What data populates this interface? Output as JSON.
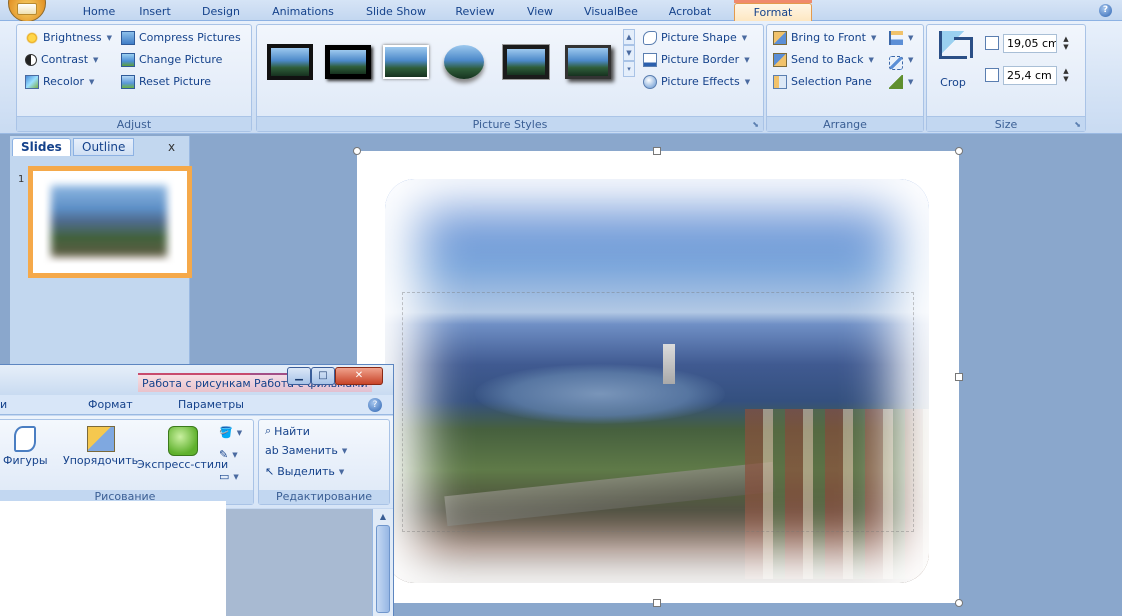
{
  "ribbon_tabs": [
    {
      "label": "Home"
    },
    {
      "label": "Insert"
    },
    {
      "label": "Design"
    },
    {
      "label": "Animations"
    },
    {
      "label": "Slide Show"
    },
    {
      "label": "Review"
    },
    {
      "label": "View"
    },
    {
      "label": "VisualBee"
    },
    {
      "label": "Acrobat"
    },
    {
      "label": "Format"
    }
  ],
  "active_tab": "Format",
  "adjust": {
    "brightness": "Brightness",
    "contrast": "Contrast",
    "recolor": "Recolor",
    "compress": "Compress Pictures",
    "change": "Change Picture",
    "reset": "Reset Picture",
    "label": "Adjust"
  },
  "picture_styles": {
    "shape": "Picture Shape",
    "border": "Picture Border",
    "effects": "Picture Effects",
    "label": "Picture Styles"
  },
  "arrange": {
    "front": "Bring to Front",
    "back": "Send to Back",
    "pane": "Selection Pane",
    "label": "Arrange"
  },
  "size": {
    "crop": "Crop",
    "height": "19,05 cm",
    "width": "25,4 cm",
    "label": "Size"
  },
  "slides_pane": {
    "tab_slides": "Slides",
    "tab_outline": "Outline",
    "close": "x",
    "slide_number": "1"
  },
  "word_window": {
    "context_tab_pictures": "Работа с рисунками",
    "context_tab_movies": "Работа с фильмами",
    "tab_format": "Формат",
    "tab_params": "Параметры",
    "tab_partial": "и",
    "shapes": "Фигуры",
    "arrange": "Упорядочить",
    "express_styles": "Экспресс-стили",
    "drawing_group": "Рисование",
    "find": "Найти",
    "replace": "Заменить",
    "select": "Выделить",
    "editing_group": "Редактирование"
  },
  "colors": {
    "active_tab_accent": "#f08a6c",
    "ribbon_bg": "#dbe7f7",
    "slide_selected": "#f5a94a"
  }
}
